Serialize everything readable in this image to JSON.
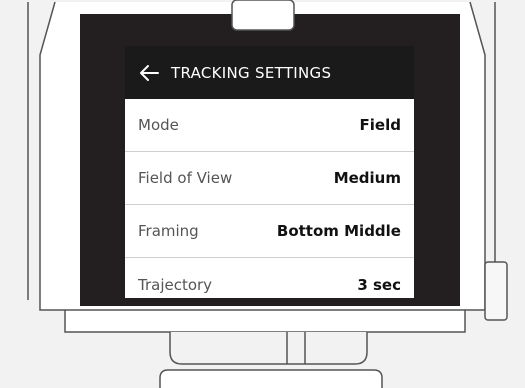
{
  "header": {
    "title": "TRACKING SETTINGS",
    "back_icon": "arrow-left-icon"
  },
  "settings": [
    {
      "label": "Mode",
      "value": "Field"
    },
    {
      "label": "Field of View",
      "value": "Medium"
    },
    {
      "label": "Framing",
      "value": "Bottom Middle"
    },
    {
      "label": "Trajectory",
      "value": "3 sec"
    }
  ],
  "colors": {
    "background": "#f2f2f2",
    "bezel": "#231f20",
    "header": "#1a1a1a",
    "panel": "#ffffff",
    "divider": "#cfcfcf",
    "outline": "#555555"
  }
}
